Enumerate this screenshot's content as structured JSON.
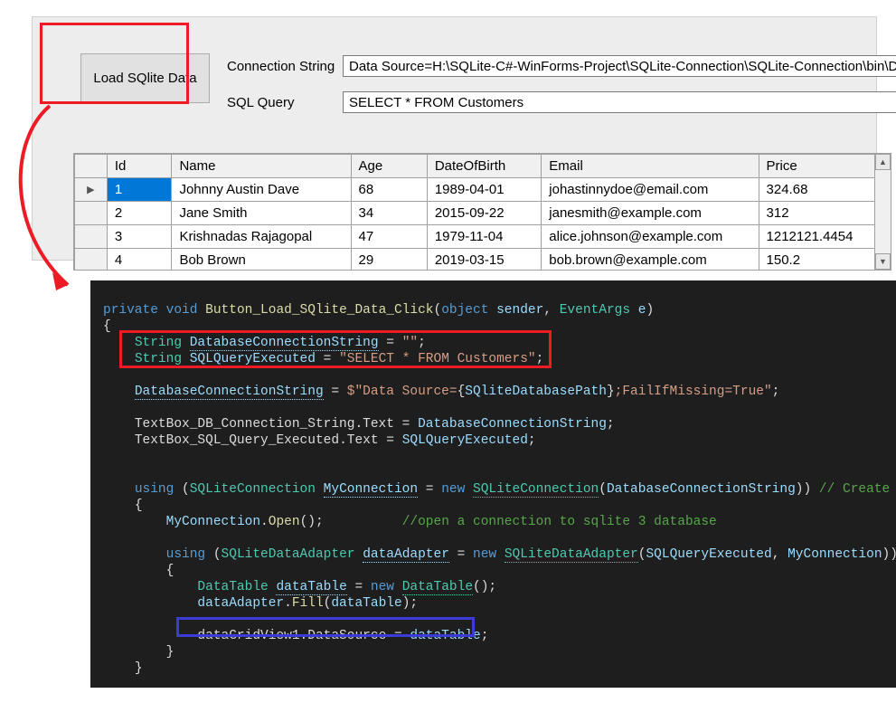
{
  "form": {
    "load_button_label": "Load SQlite Data",
    "conn_label": "Connection String",
    "query_label": "SQL Query",
    "conn_value": "Data Source=H:\\SQLite-C#-WinForms-Project\\SQLite-Connection\\SQLite-Connection\\bin\\Deb",
    "query_value": "SELECT * FROM Customers"
  },
  "grid": {
    "columns": [
      "Id",
      "Name",
      "Age",
      "DateOfBirth",
      "Email",
      "Price"
    ],
    "rows": [
      {
        "id": "1",
        "name": "Johnny Austin Dave",
        "age": "68",
        "dob": "1989-04-01",
        "email": "johastinnydoe@email.com",
        "price": "324.68",
        "current": true
      },
      {
        "id": "2",
        "name": "Jane Smith",
        "age": "34",
        "dob": "2015-09-22",
        "email": "janesmith@example.com",
        "price": "312"
      },
      {
        "id": "3",
        "name": "Krishnadas Rajagopal",
        "age": "47",
        "dob": "1979-11-04",
        "email": "alice.johnson@example.com",
        "price": "1212121.4454"
      },
      {
        "id": "4",
        "name": "Bob Brown",
        "age": "29",
        "dob": "2019-03-15",
        "email": "bob.brown@example.com",
        "price": "150.2"
      }
    ]
  },
  "code": {
    "t01a": "private",
    "t01b": "void",
    "t01c": "Button_Load_SQlite_Data_Click",
    "t01d": "object",
    "t01e": "sender",
    "t01f": "EventArgs",
    "t01g": "e",
    "t02": "{",
    "t03a": "String",
    "t03b": "DatabaseConnectionString",
    "t03c": "\"\"",
    "t04a": "String",
    "t04b": "SQLQueryExecuted",
    "t04c": "\"SELECT * FROM Customers\"",
    "t05a": "DatabaseConnectionString",
    "t05b": "$\"Data Source=",
    "t05c": "SQliteDatabasePath",
    "t05d": ";FailIfMissing=True\"",
    "t06a": "TextBox_DB_Connection_String",
    "t06b": "Text",
    "t06c": "DatabaseConnectionString",
    "t07a": "TextBox_SQL_Query_Executed",
    "t07b": "Text",
    "t07c": "SQLQueryExecuted",
    "t08a": "using",
    "t08b": "SQLiteConnection",
    "t08c": "MyConnection",
    "t08d": "new",
    "t08e": "SQLiteConnection",
    "t08f": "DatabaseConnectionString",
    "t08g": "// Create a S",
    "t09a": "MyConnection",
    "t09b": "Open",
    "t09c": "//open a connection to sqlite 3 database",
    "t10a": "using",
    "t10b": "SQLiteDataAdapter",
    "t10c": "dataAdapter",
    "t10d": "new",
    "t10e": "SQLiteDataAdapter",
    "t10f": "SQLQueryExecuted",
    "t10g": "MyConnection",
    "t11a": "DataTable",
    "t11b": "dataTable",
    "t11c": "new",
    "t11d": "DataTable",
    "t12a": "dataAdapter",
    "t12b": "Fill",
    "t12c": "dataTable",
    "t13a": "dataGridView1",
    "t13b": "DataSource",
    "t13c": "dataTable"
  }
}
